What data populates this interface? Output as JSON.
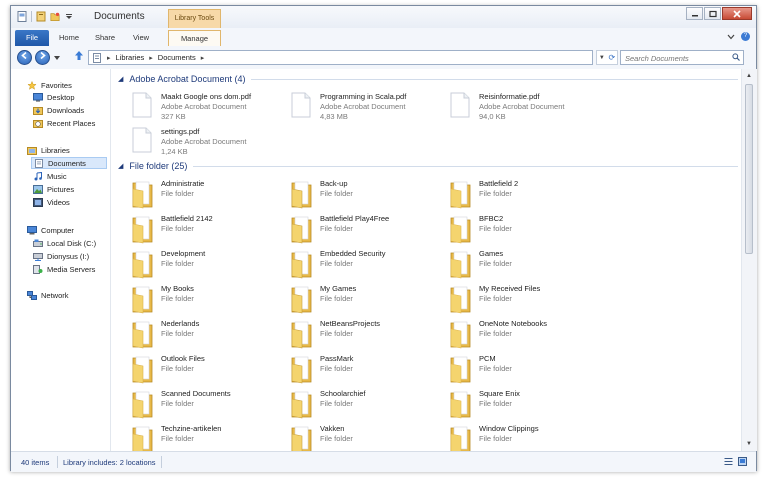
{
  "window": {
    "title": "Documents",
    "context_tab": "Library Tools"
  },
  "ribbon": {
    "tabs": [
      "File",
      "Home",
      "Share",
      "View",
      "Manage"
    ]
  },
  "address": {
    "crumbs": [
      "Libraries",
      "Documents"
    ],
    "search_placeholder": "Search Documents"
  },
  "nav": {
    "favorites_label": "Favorites",
    "favorites": [
      "Desktop",
      "Downloads",
      "Recent Places"
    ],
    "libraries_label": "Libraries",
    "libraries": [
      "Documents",
      "Music",
      "Pictures",
      "Videos"
    ],
    "computer_label": "Computer",
    "computer": [
      "Local Disk (C:)",
      "Dionysus (I:)",
      "Media Servers"
    ],
    "network_label": "Network"
  },
  "groups": {
    "pdf_header": "Adobe Acrobat Document (4)",
    "folder_header": "File folder (25)"
  },
  "pdfs": [
    {
      "name": "Maakt Google ons dom.pdf",
      "type": "Adobe Acrobat Document",
      "size": "327 KB"
    },
    {
      "name": "Programming in Scala.pdf",
      "type": "Adobe Acrobat Document",
      "size": "4,83 MB"
    },
    {
      "name": "Reisinformatie.pdf",
      "type": "Adobe Acrobat Document",
      "size": "94,0 KB"
    },
    {
      "name": "settings.pdf",
      "type": "Adobe Acrobat Document",
      "size": "1,24 KB"
    }
  ],
  "folders": [
    {
      "name": "Administratie",
      "type": "File folder"
    },
    {
      "name": "Back-up",
      "type": "File folder"
    },
    {
      "name": "Battlefield 2",
      "type": "File folder"
    },
    {
      "name": "Battlefield 2142",
      "type": "File folder"
    },
    {
      "name": "Battlefield Play4Free",
      "type": "File folder"
    },
    {
      "name": "BFBC2",
      "type": "File folder"
    },
    {
      "name": "Development",
      "type": "File folder"
    },
    {
      "name": "Embedded Security",
      "type": "File folder"
    },
    {
      "name": "Games",
      "type": "File folder"
    },
    {
      "name": "My Books",
      "type": "File folder"
    },
    {
      "name": "My Games",
      "type": "File folder"
    },
    {
      "name": "My Received Files",
      "type": "File folder"
    },
    {
      "name": "Nederlands",
      "type": "File folder"
    },
    {
      "name": "NetBeansProjects",
      "type": "File folder"
    },
    {
      "name": "OneNote Notebooks",
      "type": "File folder"
    },
    {
      "name": "Outlook Files",
      "type": "File folder"
    },
    {
      "name": "PassMark",
      "type": "File folder"
    },
    {
      "name": "PCM",
      "type": "File folder"
    },
    {
      "name": "Scanned Documents",
      "type": "File folder"
    },
    {
      "name": "Schoolarchief",
      "type": "File folder"
    },
    {
      "name": "Square Enix",
      "type": "File folder"
    },
    {
      "name": "Techzine-artikelen",
      "type": "File folder"
    },
    {
      "name": "Vakken",
      "type": "File folder"
    },
    {
      "name": "Window Clippings",
      "type": "File folder"
    }
  ],
  "status": {
    "items": "40 items",
    "library": "Library includes: 2 locations"
  },
  "colors": {
    "accent": "#2a62b8",
    "folder": "#f0c75a",
    "context_tab": "#f7d9a8",
    "selection": "#d9e8fb"
  }
}
